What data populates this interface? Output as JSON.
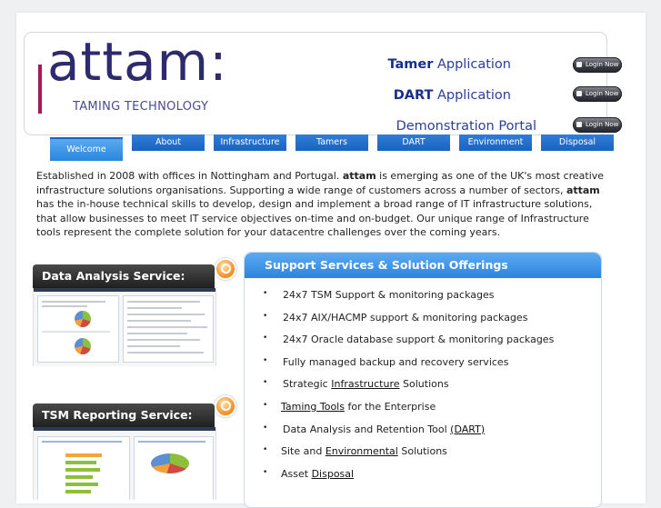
{
  "brand": {
    "logo_text": "attam:",
    "tagline": "TAMING TECHNOLOGY"
  },
  "header_links": [
    {
      "strong": "Tamer",
      "rest": " Application",
      "button": "Login Now"
    },
    {
      "strong": "DART",
      "rest": " Application",
      "button": "Login Now"
    },
    {
      "strong": "",
      "rest": "Demonstration Portal",
      "button": "Login Now"
    }
  ],
  "nav": {
    "tabs": [
      "Welcome",
      "About",
      "Infrastructure",
      "Tamers",
      "DART",
      "Environment",
      "Disposal"
    ],
    "active": "Welcome"
  },
  "intro": {
    "p1": "Established in 2008 with offices in Nottingham and Portugal. ",
    "b1": "attam",
    "p2": " is emerging as one of the UK's most creative infrastructure solutions organisations. Supporting a wide range of customers across a number of sectors, ",
    "b2": "attam",
    "p3": " has the in-house technical skills to develop, design and implement a broad range of IT infrastructure solutions, that allow businesses to meet IT service objectives on-time and on-budget. Our unique range of Infrastructure tools represent the complete solution for your datacentre challenges over the coming years."
  },
  "panels": [
    {
      "title": "Data Analysis Service:"
    },
    {
      "title": "TSM Reporting Service:"
    }
  ],
  "support": {
    "title": "Support Services & Solution Offerings",
    "items": [
      {
        "pre": "24x7 TSM Support & monitoring packages",
        "link": "",
        "post": ""
      },
      {
        "pre": "24x7 AIX/HACMP support & monitoring packages",
        "link": "",
        "post": ""
      },
      {
        "pre": "24x7 Oracle database support & monitoring packages",
        "link": "",
        "post": ""
      },
      {
        "pre": "Fully managed backup and recovery services",
        "link": "",
        "post": ""
      },
      {
        "pre": "Strategic ",
        "link": "Infrastructure",
        "post": " Solutions"
      },
      {
        "pre": "",
        "link": "Taming Tools",
        "post": " for the Enterprise"
      },
      {
        "pre": "Data Analysis and Retention Tool ",
        "link": "(DART)",
        "post": ""
      },
      {
        "pre": "Site and ",
        "link": "Environmental",
        "post": " Solutions"
      },
      {
        "pre": "Asset ",
        "link": "Disposal",
        "post": ""
      }
    ]
  },
  "colors": {
    "nav_blue": "#1b63c0",
    "logo_navy": "#2e2a6e",
    "logo_accent": "#a6195a",
    "link_blue": "#2a3e9a"
  }
}
